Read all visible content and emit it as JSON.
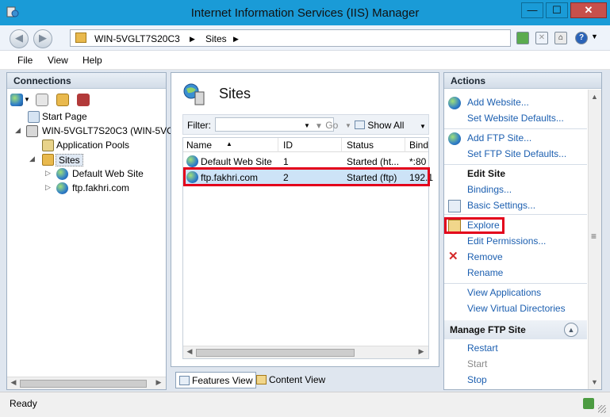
{
  "window": {
    "title": "Internet Information Services (IIS) Manager",
    "min_label": "—",
    "max_label": "☐",
    "close_label": "✕"
  },
  "address": {
    "segments": [
      "WIN-5VGLT7S20C3",
      "▶",
      "Sites",
      "▶"
    ]
  },
  "menu": {
    "items": [
      "File",
      "View",
      "Help"
    ]
  },
  "connections": {
    "title": "Connections",
    "tree": [
      {
        "label": "Start Page",
        "icon": "start-page-icon"
      },
      {
        "label": "WIN-5VGLT7S20C3 (WIN-5VG",
        "icon": "server-icon",
        "expander": "◢"
      },
      {
        "label": "Application Pools",
        "icon": "app-pools-icon"
      },
      {
        "label": "Sites",
        "icon": "sites-folder-icon",
        "expander": "◢"
      },
      {
        "label": "Default Web Site",
        "icon": "globe-icon",
        "expander": "▷"
      },
      {
        "label": "ftp.fakhri.com",
        "icon": "globe-icon",
        "expander": "▷"
      }
    ]
  },
  "center": {
    "title": "Sites",
    "filter_label": "Filter:",
    "go_label": "Go",
    "show_all_label": "Show All",
    "columns": [
      "Name",
      "ID",
      "Status",
      "Bind"
    ],
    "rows": [
      {
        "name": "Default Web Site",
        "id": "1",
        "status": "Started (ht...",
        "binding": "*:80"
      },
      {
        "name": "ftp.fakhri.com",
        "id": "2",
        "status": "Started (ftp)",
        "binding": "192.1"
      }
    ],
    "selected_row": 1
  },
  "views": {
    "features_label": "Features View",
    "content_label": "Content View",
    "active": "features"
  },
  "actions": {
    "title": "Actions",
    "items": [
      {
        "label": "Add Website...",
        "icon": "add-website-icon"
      },
      {
        "label": "Set Website Defaults..."
      },
      {
        "label": "Add FTP Site...",
        "icon": "add-ftp-icon"
      },
      {
        "label": "Set FTP Site Defaults..."
      },
      {
        "label": "Bindings..."
      },
      {
        "label": "Basic Settings...",
        "icon": "basic-settings-icon"
      },
      {
        "label": "Explore",
        "icon": "explore-icon",
        "highlighted": true
      },
      {
        "label": "Edit Permissions..."
      },
      {
        "label": "Remove",
        "icon": "remove-icon"
      },
      {
        "label": "Rename"
      },
      {
        "label": "View Applications"
      },
      {
        "label": "View Virtual Directories"
      },
      {
        "label": "Restart"
      },
      {
        "label": "Start",
        "disabled": true
      },
      {
        "label": "Stop"
      }
    ],
    "edit_site_header": "Edit Site",
    "manage_ftp_header": "Manage FTP Site"
  },
  "status": {
    "text": "Ready"
  },
  "colors": {
    "titlebar": "#1a9bd7",
    "link": "#1c5fb0",
    "highlight_outline": "#e3001b",
    "selected_row": "#cde3f7"
  }
}
